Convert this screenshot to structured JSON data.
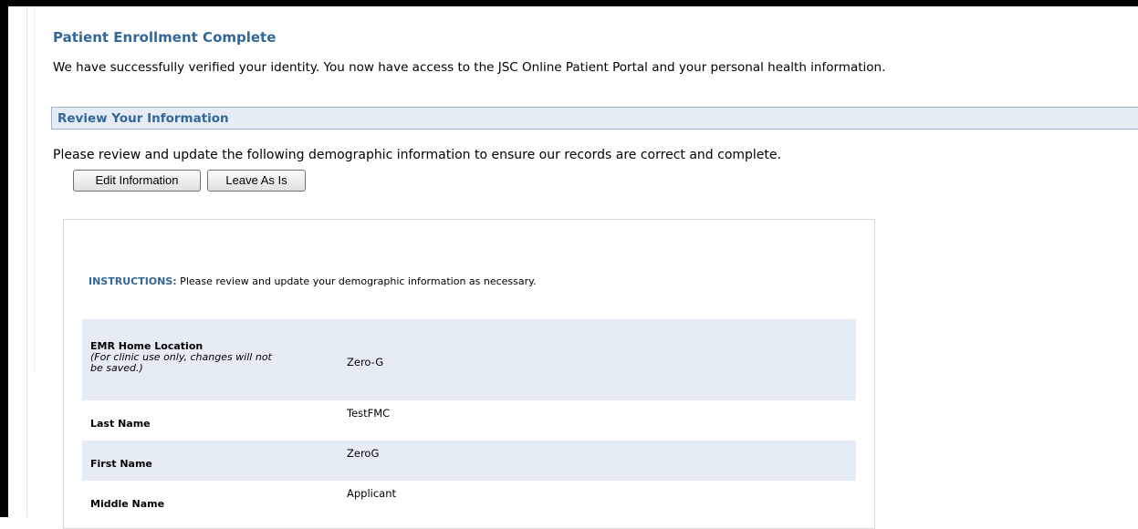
{
  "header": {
    "title": "Patient Enrollment Complete",
    "intro": "We have successfully verified your identity. You now have access to the JSC Online Patient Portal and your personal health information."
  },
  "section": {
    "title": "Review Your Information",
    "description": "Please review and update the following demographic information to ensure our records are correct and complete."
  },
  "buttons": {
    "edit": "Edit Information",
    "leave": "Leave As Is"
  },
  "form": {
    "instructions_label": "INSTRUCTIONS:",
    "instructions_text": " Please review and update your demographic information as necessary.",
    "fields": [
      {
        "label": "EMR Home Location",
        "note": "(For clinic use only, changes will not be saved.)",
        "value": "Zero-G"
      },
      {
        "label": "Last Name",
        "value": "TestFMC"
      },
      {
        "label": "First Name",
        "value": "ZeroG"
      },
      {
        "label": "Middle Name",
        "value": "Applicant"
      }
    ]
  },
  "colors": {
    "heading": "#336699",
    "section_bg": "#e6ecf5",
    "section_border": "#9fb4cf",
    "row_shade": "#e6ecf5"
  }
}
